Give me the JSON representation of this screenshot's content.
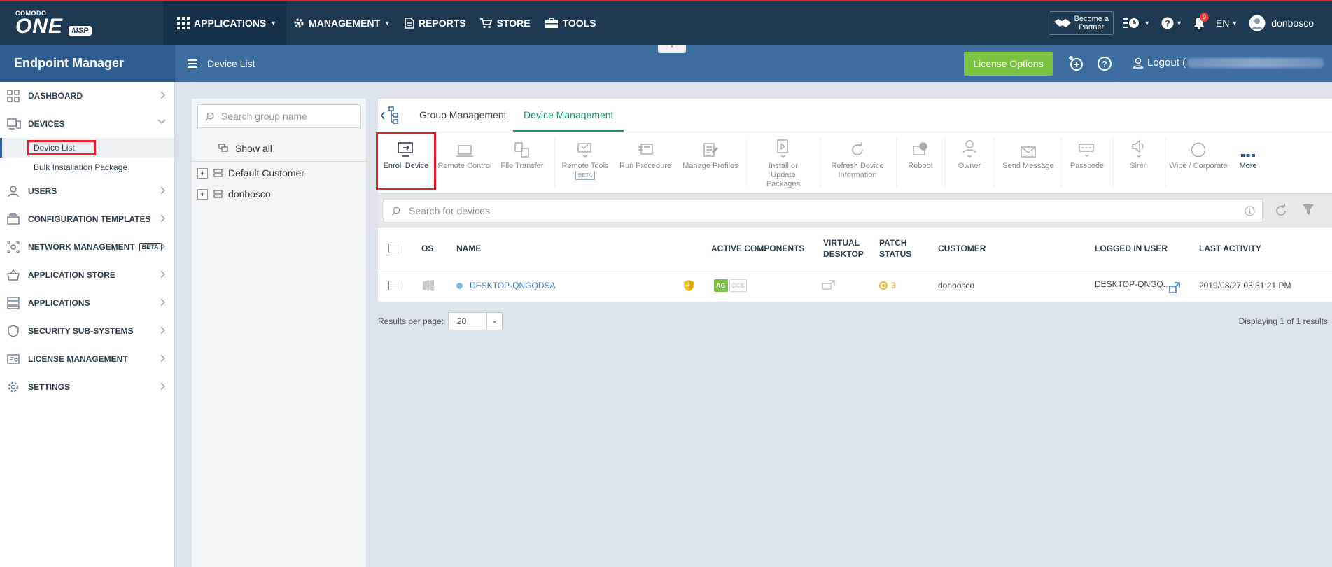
{
  "topbar": {
    "logo_small": "COMODO",
    "logo_big": "ONE",
    "logo_tag": "MSP",
    "nav": [
      {
        "label": "APPLICATIONS"
      },
      {
        "label": "MANAGEMENT"
      },
      {
        "label": "REPORTS"
      },
      {
        "label": "STORE"
      },
      {
        "label": "TOOLS"
      }
    ],
    "partner_line1": "Become a",
    "partner_line2": "Partner",
    "notifications_count": "9",
    "language": "EN",
    "username": "donbosco"
  },
  "subbar": {
    "app_title": "Endpoint Manager",
    "breadcrumb": "Device List",
    "license_button": "License Options",
    "logout_label": "Logout ("
  },
  "sidebar": {
    "items": [
      {
        "label": "DASHBOARD",
        "icon": "dashboard-icon"
      },
      {
        "label": "DEVICES",
        "icon": "devices-icon"
      },
      {
        "label": "USERS",
        "icon": "user-icon"
      },
      {
        "label": "CONFIGURATION TEMPLATES",
        "icon": "templates-icon"
      },
      {
        "label": "NETWORK MANAGEMENT",
        "icon": "network-icon",
        "badge": "BETA"
      },
      {
        "label": "APPLICATION STORE",
        "icon": "basket-icon"
      },
      {
        "label": "APPLICATIONS",
        "icon": "applications-icon"
      },
      {
        "label": "SECURITY SUB-SYSTEMS",
        "icon": "shield-icon"
      },
      {
        "label": "LICENSE MANAGEMENT",
        "icon": "license-icon"
      },
      {
        "label": "SETTINGS",
        "icon": "gear-icon"
      }
    ],
    "devices_sub": [
      {
        "label": "Device List"
      },
      {
        "label": "Bulk Installation Package"
      }
    ]
  },
  "groups": {
    "search_placeholder": "Search group name",
    "show_all": "Show all",
    "items": [
      {
        "label": "Default Customer"
      },
      {
        "label": "donbosco"
      }
    ]
  },
  "tabs": [
    {
      "label": "Group Management"
    },
    {
      "label": "Device Management"
    }
  ],
  "toolbar": [
    {
      "label": "Enroll Device"
    },
    {
      "label": "Remote Control"
    },
    {
      "label": "File Transfer"
    },
    {
      "label": "Remote Tools",
      "badge": "BETA"
    },
    {
      "label": "Run Procedure"
    },
    {
      "label": "Manage Profiles"
    },
    {
      "label": "Install or Update Packages"
    },
    {
      "label": "Refresh Device Information"
    },
    {
      "label": "Reboot"
    },
    {
      "label": "Owner"
    },
    {
      "label": "Send Message"
    },
    {
      "label": "Passcode"
    },
    {
      "label": "Siren"
    },
    {
      "label": "Wipe / Corporate"
    },
    {
      "label": "More"
    }
  ],
  "device_search_placeholder": "Search for devices",
  "table": {
    "headers": {
      "os": "OS",
      "name": "NAME",
      "active_components": "ACTIVE COMPONENTS",
      "virtual_desktop": "VIRTUAL DESKTOP",
      "patch_status": "PATCH STATUS",
      "customer": "CUSTOMER",
      "logged_in_user": "LOGGED IN USER",
      "last_activity": "LAST ACTIVITY"
    },
    "rows": [
      {
        "name": "DESKTOP-QNGQDSA",
        "comp_ag": "AG",
        "comp_ccs": "CCS",
        "patch_count": "3",
        "customer": "donbosco",
        "logged_in_user": "DESKTOP-QNGQ...",
        "last_activity": "2019/08/27 03:51:21 PM"
      }
    ]
  },
  "footer": {
    "results_per_page_label": "Results per page:",
    "results_per_page_value": "20",
    "displaying": "Displaying 1 of 1 results"
  },
  "colors": {
    "topbar": "#1e3a52",
    "subbar": "#3e6da0",
    "accent_green": "#7cc242",
    "active_tab": "#1e8f6a",
    "highlight_red": "#e3212b"
  }
}
